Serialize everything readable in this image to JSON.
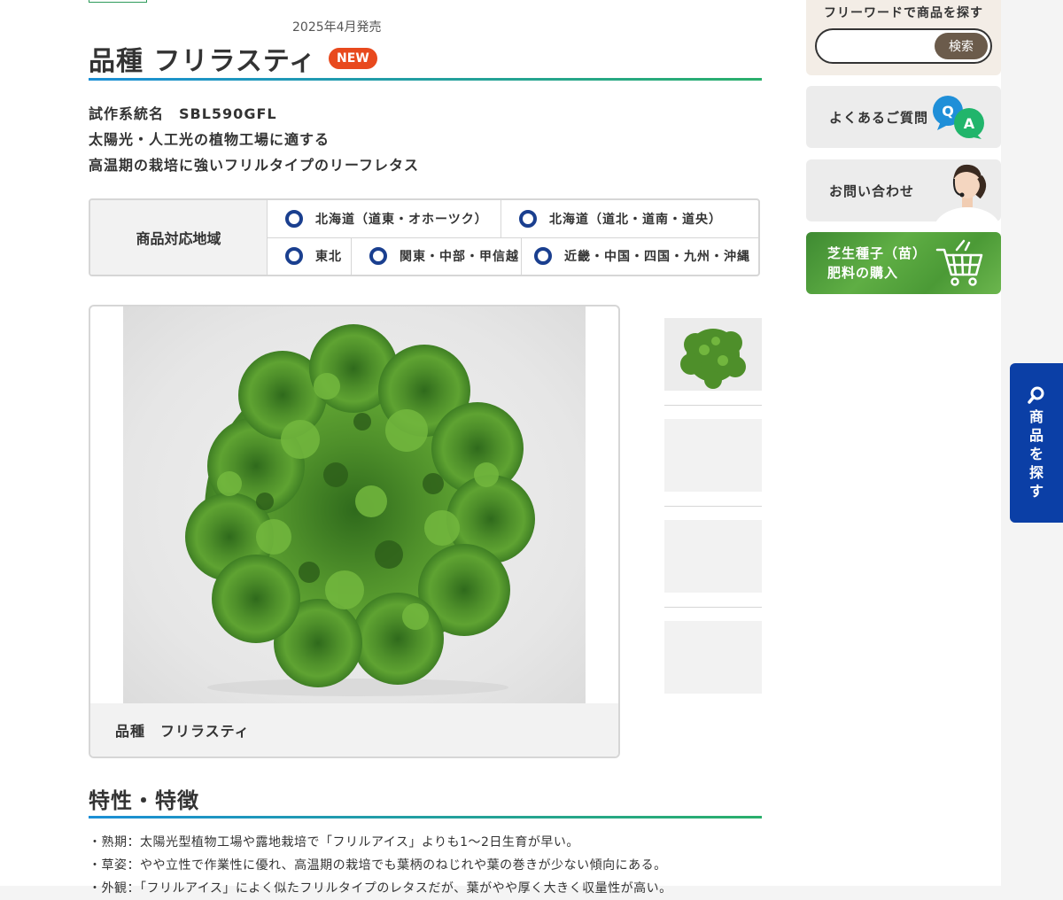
{
  "product": {
    "release": "2025年4月発売",
    "title": "品種 フリラスティ",
    "badge": "NEW",
    "desc": [
      "試作系統名　SBL590GFL",
      "太陽光・人工光の植物工場に適する",
      "高温期の栽培に強いフリルタイプのリーフレタス"
    ]
  },
  "region": {
    "label": "商品対応地域",
    "row1": [
      "北海道（道東・オホーツク）",
      "北海道（道北・道南・道央）"
    ],
    "row2": [
      "東北",
      "関東・中部・甲信越",
      "近畿・中国・四国・九州・沖縄"
    ]
  },
  "gallery": {
    "caption": "品種　フリラスティ",
    "thumbs": 4
  },
  "features": {
    "title": "特性・特徴",
    "items": [
      "・熟期：太陽光型植物工場や露地栽培で「フリルアイス」よりも1～2日生育が早い。",
      "・草姿：やや立性で作業性に優れ、高温期の栽培でも葉柄のねじれや葉の巻きが少ない傾向にある。",
      "・外観：「フリルアイス」によく似たフリルタイプのレタスだが、葉がやや厚く大きく収量性が高い。"
    ]
  },
  "sidebar": {
    "search_title": "フリーワードで商品を探す",
    "search_button": "検索",
    "faq": "よくあるご質問",
    "contact": "お問い合わせ",
    "buy_line1": "芝生種子（苗）",
    "buy_line2": "肥料の購入"
  },
  "float_search": {
    "label": "商品を探す"
  },
  "colors": {
    "accent_blue": "#0b3fa6",
    "badge_red": "#e8491d",
    "radio_navy": "#1a3f8f",
    "faq_q": "#1f8fd8",
    "faq_a": "#21b56b"
  }
}
